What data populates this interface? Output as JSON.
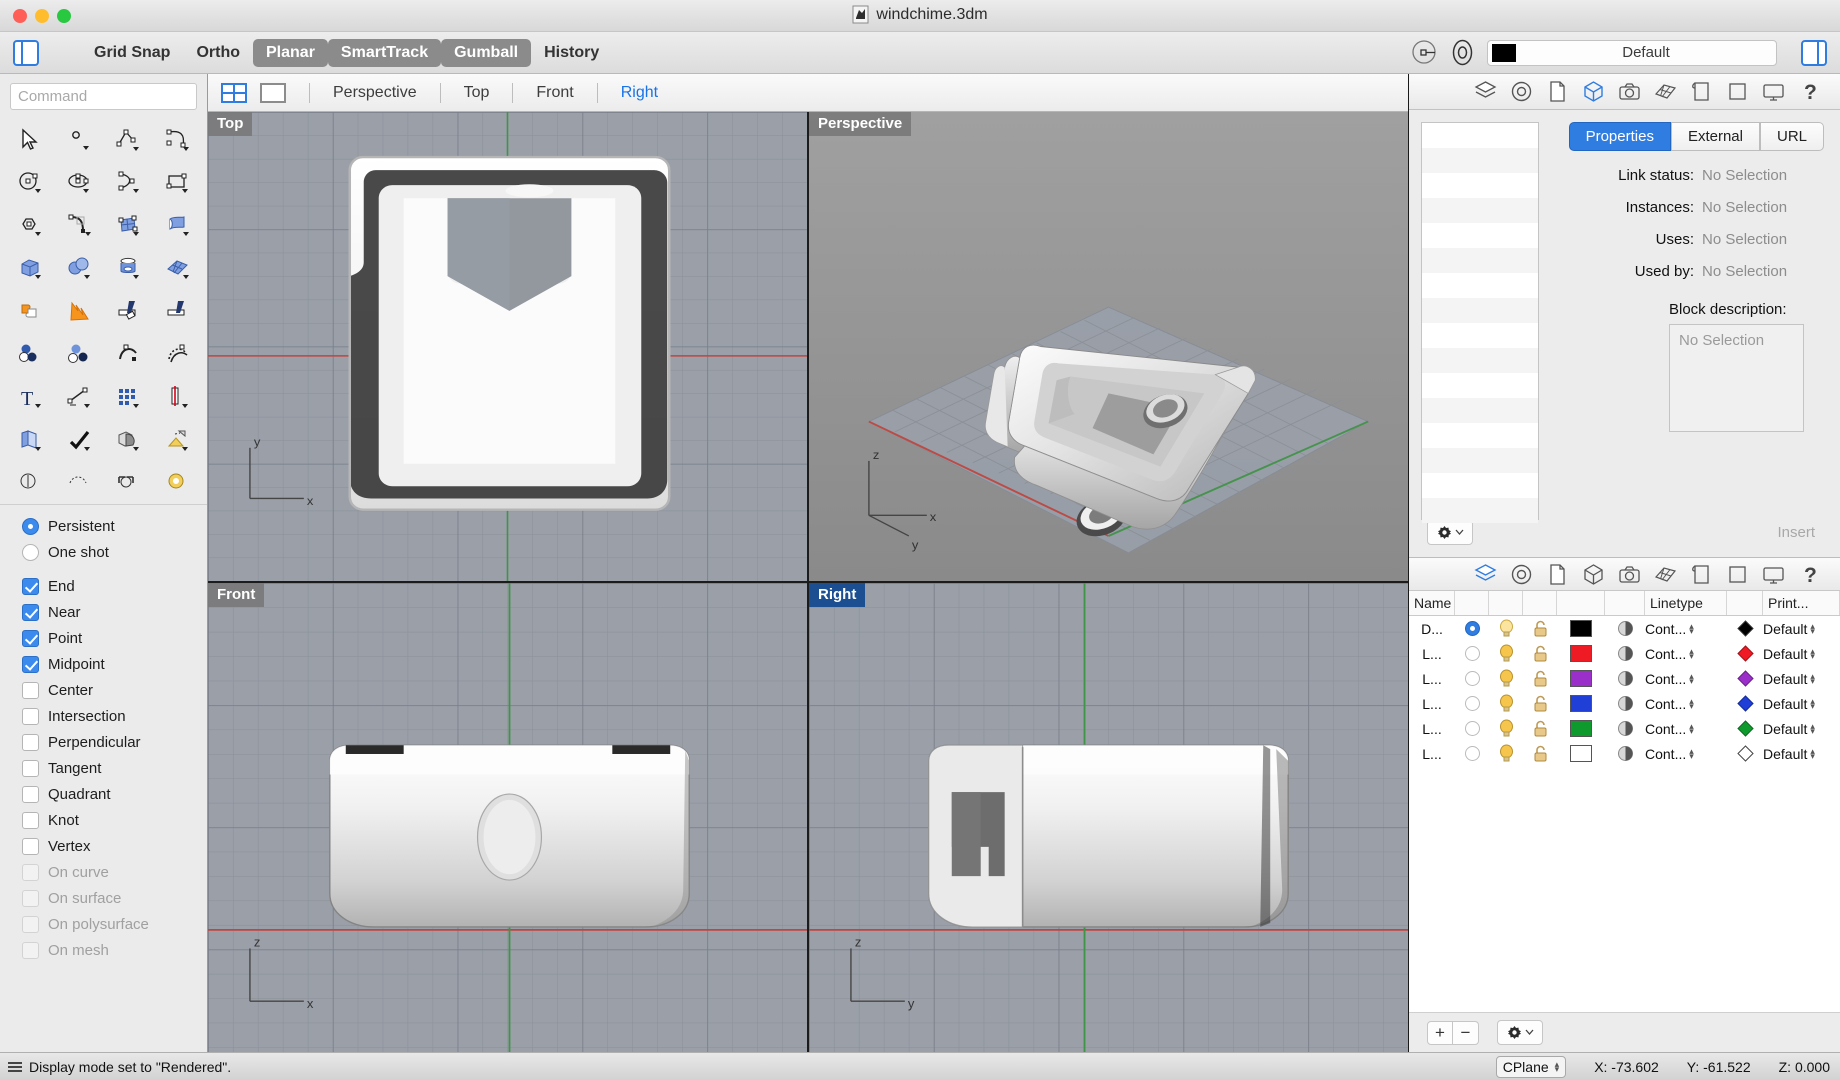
{
  "titlebar": {
    "document_title": "windchime.3dm",
    "doc_icon": "rhino-document-icon"
  },
  "toolbar": {
    "left_panel_toggle": "left-panel-toggle",
    "right_panel_toggle": "right-panel-toggle",
    "items": [
      {
        "label": "Grid Snap",
        "active": false
      },
      {
        "label": "Ortho",
        "active": false
      },
      {
        "label": "Planar",
        "active": true
      },
      {
        "label": "SmartTrack",
        "active": true
      },
      {
        "label": "Gumball",
        "active": true
      },
      {
        "label": "History",
        "active": false
      }
    ],
    "layer_color": "#000000",
    "layer_name": "Default"
  },
  "command": {
    "placeholder": "Command",
    "value": ""
  },
  "osnap": {
    "modes": [
      {
        "label": "Persistent",
        "type": "radio",
        "checked": true,
        "enabled": true
      },
      {
        "label": "One shot",
        "type": "radio",
        "checked": false,
        "enabled": true
      }
    ],
    "snaps": [
      {
        "label": "End",
        "checked": true,
        "enabled": true
      },
      {
        "label": "Near",
        "checked": true,
        "enabled": true
      },
      {
        "label": "Point",
        "checked": true,
        "enabled": true
      },
      {
        "label": "Midpoint",
        "checked": true,
        "enabled": true
      },
      {
        "label": "Center",
        "checked": false,
        "enabled": true
      },
      {
        "label": "Intersection",
        "checked": false,
        "enabled": true
      },
      {
        "label": "Perpendicular",
        "checked": false,
        "enabled": true
      },
      {
        "label": "Tangent",
        "checked": false,
        "enabled": true
      },
      {
        "label": "Quadrant",
        "checked": false,
        "enabled": true
      },
      {
        "label": "Knot",
        "checked": false,
        "enabled": true
      },
      {
        "label": "Vertex",
        "checked": false,
        "enabled": true
      },
      {
        "label": "On curve",
        "checked": false,
        "enabled": false
      },
      {
        "label": "On surface",
        "checked": false,
        "enabled": false
      },
      {
        "label": "On polysurface",
        "checked": false,
        "enabled": false
      },
      {
        "label": "On mesh",
        "checked": false,
        "enabled": false
      }
    ]
  },
  "viewport_tabs": {
    "layout_four_icon": "four-view-layout-icon",
    "layout_single_icon": "single-view-layout-icon",
    "tabs": [
      {
        "label": "Perspective",
        "active": false
      },
      {
        "label": "Top",
        "active": false
      },
      {
        "label": "Front",
        "active": false
      },
      {
        "label": "Right",
        "active": true
      }
    ]
  },
  "viewports": [
    {
      "name": "Top",
      "active": false
    },
    {
      "name": "Perspective",
      "active": false
    },
    {
      "name": "Front",
      "active": false
    },
    {
      "name": "Right",
      "active": true
    }
  ],
  "properties_panel": {
    "icons": [
      "layers-icon",
      "object-properties-icon",
      "document-icon",
      "object-icon",
      "camera-icon",
      "render-mesh-icon",
      "display-icon",
      "page-icon",
      "monitor-icon",
      "help-icon"
    ],
    "tabs": [
      {
        "label": "Properties",
        "active": true
      },
      {
        "label": "External",
        "active": false
      },
      {
        "label": "URL",
        "active": false
      }
    ],
    "rows": [
      {
        "label": "Link status:",
        "value": "No Selection"
      },
      {
        "label": "Instances:",
        "value": "No Selection"
      },
      {
        "label": "Uses:",
        "value": "No Selection"
      },
      {
        "label": "Used by:",
        "value": "No Selection"
      }
    ],
    "block_description_label": "Block description:",
    "block_description_value": "No Selection",
    "insert_label": "Insert"
  },
  "layers_panel": {
    "icons": [
      "layers-icon",
      "object-properties-icon",
      "document-icon",
      "object-icon",
      "camera-icon",
      "render-mesh-icon",
      "display-icon",
      "page-icon",
      "monitor-icon",
      "help-icon"
    ],
    "columns": [
      "Name",
      "",
      "",
      "",
      "",
      "",
      "Linetype",
      "",
      "Print..."
    ],
    "rows": [
      {
        "name": "D...",
        "current": true,
        "visible": true,
        "locked": false,
        "color": "#000000",
        "linetype": "Cont...",
        "print_color": "#000000",
        "print_width": "Default"
      },
      {
        "name": "L...",
        "current": false,
        "visible": true,
        "locked": false,
        "color": "#ee1b24",
        "linetype": "Cont...",
        "print_color": "#ee1b24",
        "print_width": "Default"
      },
      {
        "name": "L...",
        "current": false,
        "visible": true,
        "locked": false,
        "color": "#9b2fc9",
        "linetype": "Cont...",
        "print_color": "#9b2fc9",
        "print_width": "Default"
      },
      {
        "name": "L...",
        "current": false,
        "visible": true,
        "locked": false,
        "color": "#1f3fd6",
        "linetype": "Cont...",
        "print_color": "#1f3fd6",
        "print_width": "Default"
      },
      {
        "name": "L...",
        "current": false,
        "visible": true,
        "locked": false,
        "color": "#0f9a2e",
        "linetype": "Cont...",
        "print_color": "#0f9a2e",
        "print_width": "Default"
      },
      {
        "name": "L...",
        "current": false,
        "visible": true,
        "locked": false,
        "color": "#ffffff",
        "linetype": "Cont...",
        "print_color": "#ffffff",
        "print_width": "Default"
      }
    ],
    "add_label": "+",
    "remove_label": "−"
  },
  "statusbar": {
    "message": "Display mode set to \"Rendered\".",
    "cplane_label": "CPlane",
    "x": "X: -73.602",
    "y": "Y: -61.522",
    "z": "Z: 0.000"
  }
}
